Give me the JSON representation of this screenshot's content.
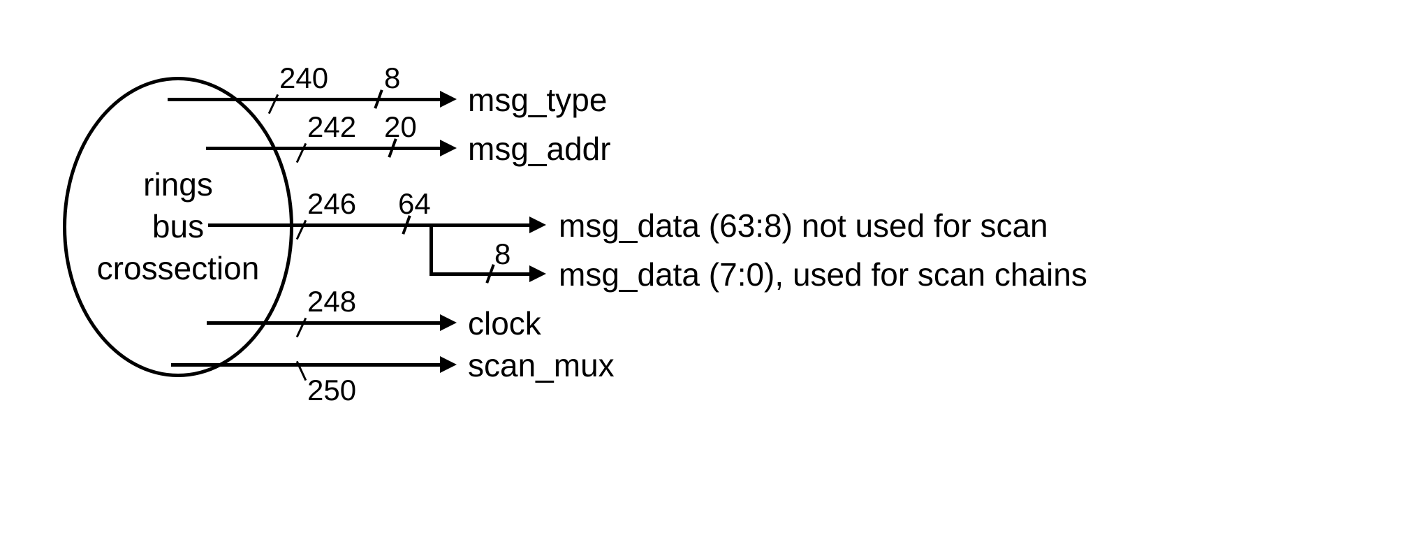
{
  "ellipse_label": "rings\nbus\ncrossection",
  "signals": {
    "msg_type": {
      "ref": "240",
      "width": "8",
      "label": "msg_type"
    },
    "msg_addr": {
      "ref": "242",
      "width": "20",
      "label": "msg_addr"
    },
    "msg_data": {
      "ref": "246",
      "width": "64",
      "label_high": "msg_data (63:8) not used for scan",
      "label_low": "msg_data (7:0), used for scan chains",
      "branch_width": "8"
    },
    "clock": {
      "ref": "248",
      "label": "clock"
    },
    "scan_mux": {
      "ref": "250",
      "label": "scan_mux"
    }
  }
}
